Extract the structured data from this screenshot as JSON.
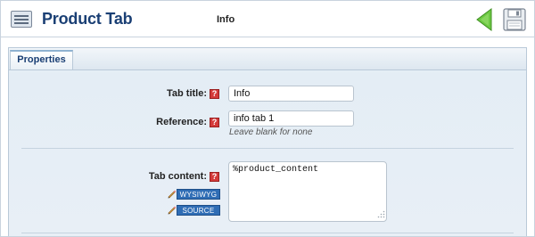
{
  "header": {
    "title": "Product Tab",
    "tab_name": "Info",
    "icons": {
      "app": "list-window-icon",
      "back": "back-arrow-icon",
      "save": "floppy-disk-icon"
    }
  },
  "tabs": [
    {
      "label": "Properties",
      "active": true
    }
  ],
  "form": {
    "tab_title": {
      "label": "Tab title:",
      "value": "Info"
    },
    "reference": {
      "label": "Reference:",
      "value": "info tab 1",
      "hint": "Leave blank for none"
    },
    "tab_content": {
      "label": "Tab content:",
      "value": "%product_content"
    },
    "help_glyph": "?",
    "editor_modes": [
      "WYSIWYG",
      "SOURCE"
    ]
  },
  "colors": {
    "title": "#1a3f74",
    "back_arrow": "#5fbf3a",
    "help_badge": "#d43a3a",
    "mode_button": "#2f6db5"
  }
}
